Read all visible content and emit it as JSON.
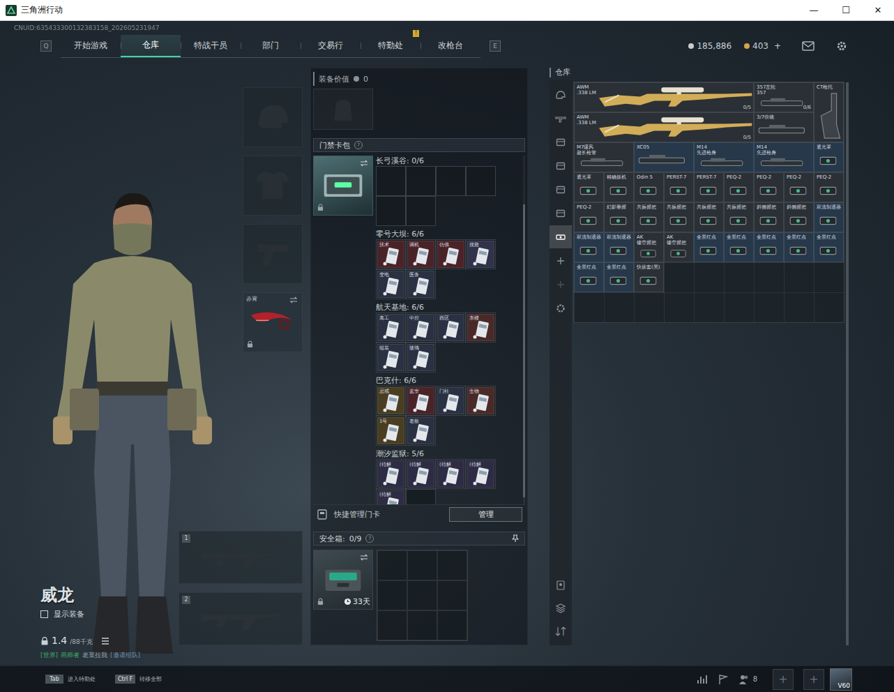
{
  "window": {
    "title": "三角洲行动",
    "controls": [
      "—",
      "☐",
      "✕"
    ]
  },
  "uid": "CNUID:635433300132383158_202605231947",
  "nav": {
    "prev_key": "Q",
    "next_key": "E",
    "tabs": [
      {
        "label": "开始游戏",
        "selected": false,
        "badge": ""
      },
      {
        "label": "仓库",
        "selected": true,
        "badge": ""
      },
      {
        "label": "特战干员",
        "selected": false,
        "badge": ""
      },
      {
        "label": "部门",
        "selected": false,
        "badge": ""
      },
      {
        "label": "交易行",
        "selected": false,
        "badge": ""
      },
      {
        "label": "特勤处",
        "selected": false,
        "badge": "!"
      },
      {
        "label": "改枪台",
        "selected": false,
        "badge": ""
      }
    ]
  },
  "currency": [
    {
      "amount": "185,886",
      "plus": "",
      "color": "#c9ccd0"
    },
    {
      "amount": "403",
      "plus": "+",
      "color": "#d6a24a"
    }
  ],
  "character": {
    "name": "威龙",
    "show_gear": {
      "label": "显示装备",
      "checked": false
    },
    "weight": "1.4",
    "weight_max": "/88千克",
    "chat": [
      {
        "text": "[世界]",
        "color": "#3fae6a"
      },
      {
        "text": "画师者",
        "color": "#3fae6a"
      },
      {
        "text": "老菜拉我",
        "color": "#9aa3aa"
      },
      {
        "text": "[邀请组队]",
        "color": "#6f8fa8"
      }
    ]
  },
  "equipment": [
    {
      "kind": "helmet",
      "label": "",
      "locked": false
    },
    {
      "kind": "armor",
      "label": "",
      "locked": false
    },
    {
      "kind": "pistol",
      "label": "",
      "locked": false
    },
    {
      "kind": "knife",
      "label": "赤霄",
      "locked": true
    }
  ],
  "weapon_slots": [
    {
      "number": "1"
    },
    {
      "number": "2"
    }
  ],
  "loadout": {
    "label": "装备价值",
    "value": "0"
  },
  "keycards": {
    "title": "门禁卡包",
    "help": "?",
    "locked": true,
    "maps": [
      {
        "name": "长弓溪谷:",
        "count": "0/6",
        "cards": []
      },
      {
        "name": "零号大坝:",
        "count": "6/6",
        "cards": [
          {
            "label": "技术",
            "color": "#4a2328"
          },
          {
            "label": "调机",
            "color": "#4a2328"
          },
          {
            "label": "仿佛",
            "color": "#4a2328"
          },
          {
            "label": "搜救",
            "color": "#30334a"
          },
          {
            "label": "变电",
            "color": "#2a3142"
          },
          {
            "label": "医务",
            "color": "#2a3142"
          }
        ]
      },
      {
        "name": "航天基地:",
        "count": "6/6",
        "cards": [
          {
            "label": "离工",
            "color": "#2a3142"
          },
          {
            "label": "中控",
            "color": "#2a3142"
          },
          {
            "label": "西区",
            "color": "#2a3142"
          },
          {
            "label": "东楼",
            "color": "#4a2a28"
          },
          {
            "label": "组装",
            "color": "#2a3142"
          },
          {
            "label": "玻璃",
            "color": "#2a3142"
          }
        ]
      },
      {
        "name": "巴克什:",
        "count": "6/6",
        "cards": [
          {
            "label": "忌戒",
            "color": "#4a3e22"
          },
          {
            "label": "蓝室",
            "color": "#4a2328"
          },
          {
            "label": "门柱",
            "color": "#2a3142"
          },
          {
            "label": "生物",
            "color": "#4a2a28"
          },
          {
            "label": "1号",
            "color": "#4a3e22"
          },
          {
            "label": "老板",
            "color": "#2a3142"
          }
        ]
      },
      {
        "name": "潮汐监狱:",
        "count": "5/6",
        "cards": [
          {
            "label": "(待解",
            "color": "#2e2c44"
          },
          {
            "label": "(待解",
            "color": "#2e2c44"
          },
          {
            "label": "(待解",
            "color": "#2e2c44"
          },
          {
            "label": "(待解",
            "color": "#2e2c44"
          },
          {
            "label": "(待解",
            "color": "#2e2c44"
          }
        ]
      }
    ]
  },
  "quick_manage": {
    "label": "快捷管理门卡",
    "button": "管理"
  },
  "safe_box": {
    "title": "安全箱:",
    "count": "0/9",
    "help": "?",
    "timer": "33天",
    "locked": true
  },
  "warehouse": {
    "title": "仓库",
    "tabs": [
      {
        "kind": "helmet",
        "selected": false,
        "disabled": false
      },
      {
        "kind": "gun",
        "selected": false,
        "disabled": false
      },
      {
        "kind": "case",
        "selected": false,
        "disabled": false
      },
      {
        "kind": "box",
        "selected": false,
        "disabled": false
      },
      {
        "kind": "ammo",
        "selected": false,
        "disabled": false
      },
      {
        "kind": "bag",
        "selected": false,
        "disabled": false
      },
      {
        "kind": "attachment",
        "selected": true,
        "disabled": false
      },
      {
        "kind": "add",
        "selected": false,
        "disabled": false
      },
      {
        "kind": "add",
        "selected": false,
        "disabled": true
      },
      {
        "kind": "gear",
        "selected": false,
        "disabled": false
      }
    ],
    "tools": [
      {
        "kind": "profile"
      },
      {
        "kind": "layers"
      },
      {
        "kind": "sort"
      }
    ],
    "items": [
      {
        "name": "AWM",
        "sub": ".338 LM",
        "count": "0/5",
        "kind": "long",
        "color": "#2b3036"
      },
      {
        "name": "357左轮",
        "sub": "357",
        "count": "0/6",
        "kind": "wide",
        "color": "#2b3036"
      },
      {
        "name": "CT枪托",
        "sub": "",
        "count": "",
        "kind": "tall",
        "color": "#2b3036"
      },
      {
        "name": "AWM",
        "sub": ".338 LM",
        "count": "0/5",
        "kind": "long",
        "color": "#2b3036"
      },
      {
        "name": "3/7倍镜",
        "sub": "",
        "count": "",
        "kind": "wide",
        "color": "#2b3036"
      },
      {
        "name": "M7缓风",
        "sub": "超长枪管",
        "count": "",
        "kind": "wide",
        "color": "#2b3036"
      },
      {
        "name": "XC05",
        "sub": "",
        "count": "",
        "kind": "wide",
        "color": "#26384a"
      },
      {
        "name": "M14",
        "sub": "先进枪身",
        "count": "",
        "kind": "wide",
        "color": "#26384a"
      },
      {
        "name": "M14",
        "sub": "先进枪身",
        "count": "",
        "kind": "wide",
        "color": "#26384a"
      },
      {
        "name": "遮光罩",
        "sub": "",
        "count": "",
        "kind": "small",
        "color": "#26384a"
      },
      {
        "name": "遮光罩",
        "sub": "",
        "count": "",
        "kind": "small",
        "color": "#2b3036"
      },
      {
        "name": "精确扳机",
        "sub": "",
        "count": "",
        "kind": "small",
        "color": "#2b3036"
      },
      {
        "name": "Odin 5",
        "sub": "",
        "count": "",
        "kind": "small",
        "color": "#2b3036"
      },
      {
        "name": "PERST-7",
        "sub": "",
        "count": "",
        "kind": "small",
        "color": "#2b3036"
      },
      {
        "name": "PERST-7",
        "sub": "",
        "count": "",
        "kind": "small",
        "color": "#2b3036"
      },
      {
        "name": "PEQ-2",
        "sub": "",
        "count": "",
        "kind": "small",
        "color": "#2b3036"
      },
      {
        "name": "PEQ-2",
        "sub": "",
        "count": "",
        "kind": "small",
        "color": "#2b3036"
      },
      {
        "name": "PEQ-2",
        "sub": "",
        "count": "",
        "kind": "small",
        "color": "#2b3036"
      },
      {
        "name": "PEQ-2",
        "sub": "",
        "count": "",
        "kind": "small",
        "color": "#2b3036"
      },
      {
        "name": "PEQ-2",
        "sub": "",
        "count": "",
        "kind": "small",
        "color": "#2b3036"
      },
      {
        "name": "幻影垂握",
        "sub": "",
        "count": "",
        "kind": "small",
        "color": "#2b3036"
      },
      {
        "name": "共振握把",
        "sub": "",
        "count": "",
        "kind": "small",
        "color": "#2b3036"
      },
      {
        "name": "共振握把",
        "sub": "",
        "count": "",
        "kind": "small",
        "color": "#2b3036"
      },
      {
        "name": "共振握把",
        "sub": "",
        "count": "",
        "kind": "small",
        "color": "#2b3036"
      },
      {
        "name": "共振握把",
        "sub": "",
        "count": "",
        "kind": "small",
        "color": "#2b3036"
      },
      {
        "name": "斜侧握把",
        "sub": "",
        "count": "",
        "kind": "small",
        "color": "#2b3036"
      },
      {
        "name": "斜侧握把",
        "sub": "",
        "count": "",
        "kind": "small",
        "color": "#2b3036"
      },
      {
        "name": "双流制退器",
        "sub": "",
        "count": "",
        "kind": "small",
        "color": "#26384a"
      },
      {
        "name": "双流制退器",
        "sub": "",
        "count": "",
        "kind": "small",
        "color": "#26384a"
      },
      {
        "name": "双流制退器",
        "sub": "",
        "count": "",
        "kind": "small",
        "color": "#26384a"
      },
      {
        "name": "AK",
        "sub": "镂空握把",
        "count": "",
        "kind": "small",
        "color": "#2b3036"
      },
      {
        "name": "AK",
        "sub": "镂空握把",
        "count": "",
        "kind": "small",
        "color": "#2b3036"
      },
      {
        "name": "全景红点",
        "sub": "",
        "count": "",
        "kind": "small",
        "color": "#26384a"
      },
      {
        "name": "全景红点",
        "sub": "",
        "count": "",
        "kind": "small",
        "color": "#26384a"
      },
      {
        "name": "全景红点",
        "sub": "",
        "count": "",
        "kind": "small",
        "color": "#26384a"
      },
      {
        "name": "全景红点",
        "sub": "",
        "count": "",
        "kind": "small",
        "color": "#26384a"
      },
      {
        "name": "全景红点",
        "sub": "",
        "count": "",
        "kind": "small",
        "color": "#26384a"
      },
      {
        "name": "全景红点",
        "sub": "",
        "count": "",
        "kind": "small",
        "color": "#26384a"
      },
      {
        "name": "全景红点",
        "sub": "",
        "count": "",
        "kind": "small",
        "color": "#26384a"
      },
      {
        "name": "快拔套(黑)",
        "sub": "",
        "count": "",
        "kind": "small",
        "color": "#2b3036"
      }
    ]
  },
  "hints": [
    {
      "key": "Tab",
      "label": "进入特勤处"
    },
    {
      "key": "Ctrl F",
      "label": "转移全部"
    }
  ],
  "social": {
    "friends": "8",
    "team_slots": [
      "+",
      "+"
    ],
    "avatar": "V60"
  }
}
